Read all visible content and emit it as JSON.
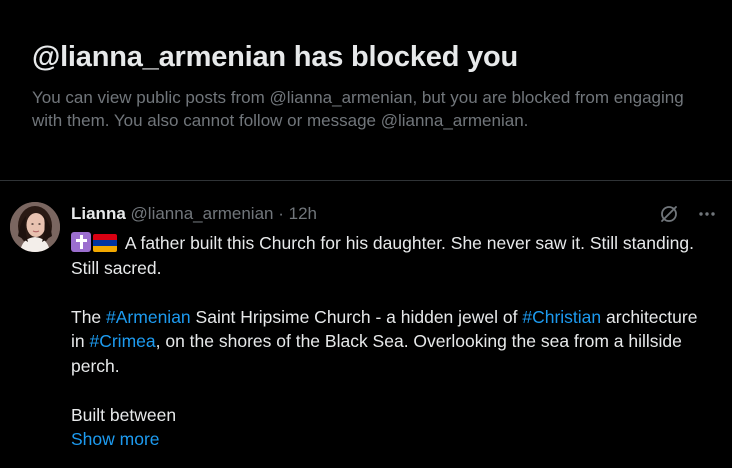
{
  "blocked": {
    "title": "@lianna_armenian has blocked you",
    "description": "You can view public posts from @lianna_armenian, but you are blocked from engaging with them. You also cannot follow or message @lianna_armenian."
  },
  "post": {
    "author_name": "Lianna",
    "author_handle": "@lianna_armenian",
    "separator": "·",
    "time": "12h",
    "emojis": [
      "latin-cross-emoji",
      "armenia-flag-emoji"
    ],
    "line1_text": " A father built this Church for his daughter. She never saw it. Still standing. Still sacred.",
    "para2": {
      "t1": "The ",
      "tag1": "#Armenian",
      "t2": " Saint Hripsime Church - a hidden jewel of ",
      "tag2": "#Christian",
      "t3": " architecture in ",
      "tag3": "#Crimea",
      "t4": ", on the shores of the Black Sea. Overlooking the sea from a hillside perch."
    },
    "para3": "Built between",
    "show_more": "Show more",
    "actions": {
      "grok_icon": "grok-icon",
      "more_icon": "more-options-icon"
    }
  },
  "colors": {
    "background": "#000000",
    "primary_text": "#e7e9ea",
    "secondary_text": "#71767b",
    "link": "#1d9bf0",
    "divider": "#2f3336"
  }
}
